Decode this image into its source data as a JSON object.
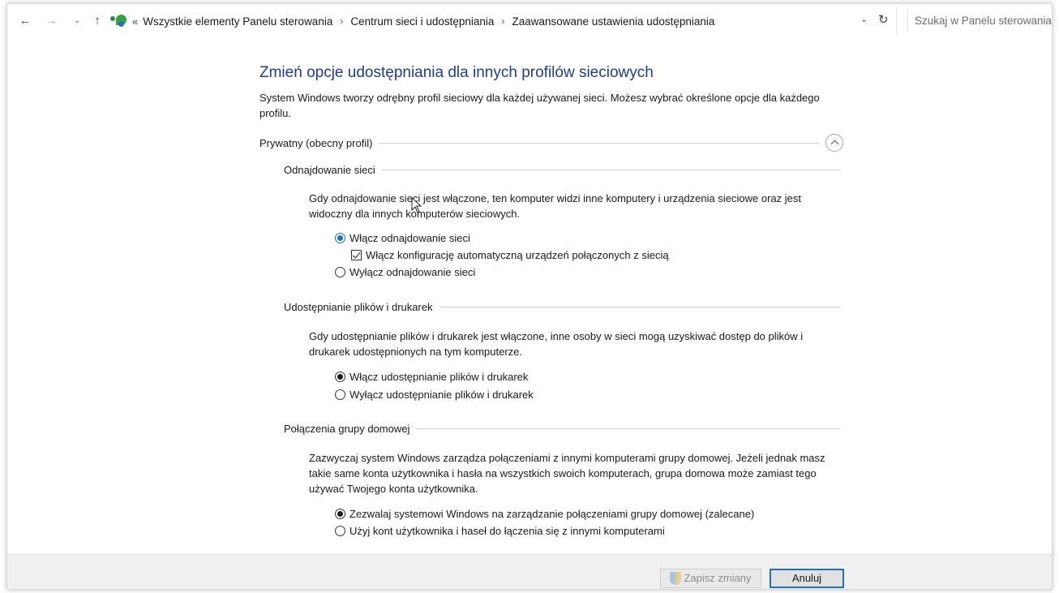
{
  "navigation": {
    "back": "←",
    "forward": "→",
    "recent": "⌄",
    "up": "↑"
  },
  "address_bar": {
    "overflow": "«",
    "crumbs": [
      "Wszystkie elementy Panelu sterowania",
      "Centrum sieci i udostępniania",
      "Zaawansowane ustawienia udostępniania"
    ],
    "separator": "›",
    "dropdown": "⌄",
    "refresh": "↻"
  },
  "search": {
    "placeholder": "Szukaj w Panelu sterowania"
  },
  "main": {
    "title": "Zmień opcje udostępniania dla innych profilów sieciowych",
    "intro": "System Windows tworzy odrębny profil sieciowy dla każdej używanej sieci. Możesz wybrać określone opcje dla każdego profilu.",
    "profile": {
      "label": "Prywatny (obecny profil)"
    },
    "network_discovery": {
      "heading": "Odnajdowanie sieci",
      "description": "Gdy odnajdowanie sieci jest włączone, ten komputer widzi inne komputery i urządzenia sieciowe oraz jest widoczny dla innych komputerów sieciowych.",
      "option_on": "Włącz odnajdowanie sieci",
      "option_auto_config": "Włącz konfigurację automatyczną urządzeń połączonych z siecią",
      "option_off": "Wyłącz odnajdowanie sieci"
    },
    "file_sharing": {
      "heading": "Udostępnianie plików i drukarek",
      "description": "Gdy udostępnianie plików i drukarek jest włączone, inne osoby w sieci mogą uzyskiwać dostęp do plików i drukarek udostępnionych na tym komputerze.",
      "option_on": "Włącz udostępnianie plików i drukarek",
      "option_off": "Wyłącz udostępnianie plików i drukarek"
    },
    "homegroup": {
      "heading": "Połączenia grupy domowej",
      "description": "Zazwyczaj system Windows zarządza połączeniami z innymi komputerami grupy domowej. Jeżeli jednak masz takie same konta użytkownika i hasła na wszystkich swoich komputerach, grupa domowa może zamiast tego używać Twojego konta użytkownika.",
      "option_windows": "Zezwalaj systemowi Windows na zarządzanie połączeniami grupy domowej (zalecane)",
      "option_accounts": "Użyj kont użytkownika i haseł do łączenia się z innymi komputerami"
    }
  },
  "footer": {
    "save": "Zapisz zmiany",
    "cancel": "Anuluj"
  },
  "colors": {
    "title": "#1e3c96",
    "accent": "#1a73c6"
  }
}
